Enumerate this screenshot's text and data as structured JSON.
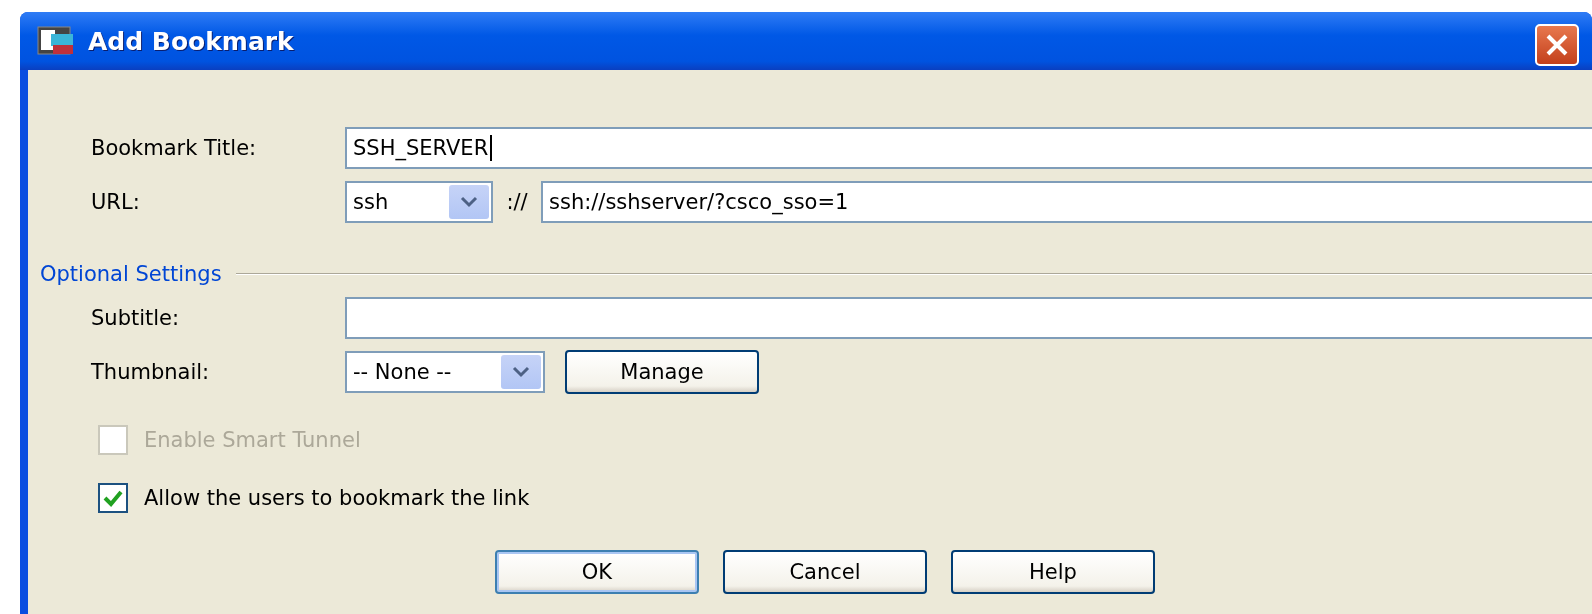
{
  "window": {
    "title": "Add Bookmark"
  },
  "bookmark_title": {
    "label": "Bookmark Title:",
    "value": "SSH_SERVER"
  },
  "url": {
    "label": "URL:",
    "protocol": "ssh",
    "separator": "://",
    "value": "ssh://sshserver/?csco_sso=1"
  },
  "optional_settings": {
    "title": "Optional Settings",
    "subtitle": {
      "label": "Subtitle:"
    },
    "thumbnail": {
      "label": "Thumbnail:",
      "value": "-- None --",
      "button": "Manage"
    }
  },
  "checkboxes": [
    {
      "label": "Enable Smart Tunnel",
      "checked": false,
      "disabled": true
    },
    {
      "label": "Allow the users to bookmark the link",
      "checked": true,
      "disabled": false
    }
  ],
  "buttons": [
    {
      "label": "OK",
      "default": true
    },
    {
      "label": "Cancel",
      "default": false
    },
    {
      "label": "Help",
      "default": false
    }
  ]
}
